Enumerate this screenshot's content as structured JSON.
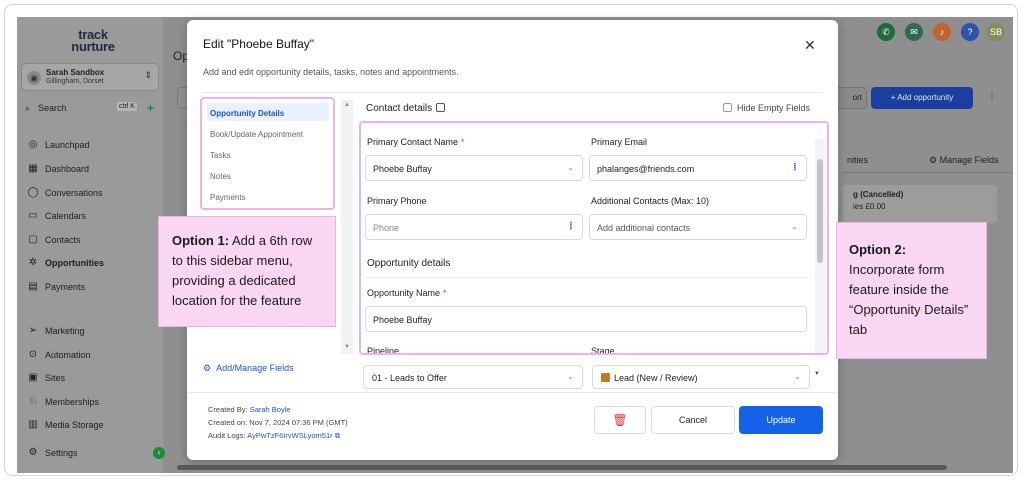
{
  "sidebar": {
    "logo_line1": "track",
    "logo_line2": "nurture",
    "account_name": "Sarah Sandbox",
    "account_location": "Gillingham, Dorset",
    "search_label": "Search",
    "search_shortcut": "ctrl K",
    "items": [
      {
        "label": "Launchpad",
        "icon": "rocket-icon"
      },
      {
        "label": "Dashboard",
        "icon": "grid-icon"
      },
      {
        "label": "Conversations",
        "icon": "chat-icon"
      },
      {
        "label": "Calendars",
        "icon": "calendar-icon"
      },
      {
        "label": "Contacts",
        "icon": "contacts-icon"
      },
      {
        "label": "Opportunities",
        "icon": "opportunities-icon"
      },
      {
        "label": "Payments",
        "icon": "payments-icon"
      },
      {
        "label": "Marketing",
        "icon": "send-icon"
      },
      {
        "label": "Automation",
        "icon": "automation-icon"
      },
      {
        "label": "Sites",
        "icon": "sites-icon"
      },
      {
        "label": "Memberships",
        "icon": "badge-icon"
      },
      {
        "label": "Media Storage",
        "icon": "folder-icon"
      },
      {
        "label": "Settings",
        "icon": "gear-icon"
      }
    ]
  },
  "background": {
    "title_fragment": "Opp",
    "port_fragment": "ort",
    "add_opportunity": "+ Add opportunity",
    "tab_fragment": "nities",
    "manage_fields": "Manage Fields",
    "card_title": "g (Cancelled)",
    "card_sub": "ies  £0.00",
    "avatar_initials": "SB"
  },
  "modal": {
    "title": "Edit \"Phoebe Buffay\"",
    "subtitle": "Add and edit opportunity details, tasks, notes and appointments.",
    "tabs": [
      "Opportunity Details",
      "Book/Update Appointment",
      "Tasks",
      "Notes",
      "Payments"
    ],
    "add_manage_fields": "Add/Manage Fields",
    "contact_details_heading": "Contact details",
    "hide_empty_fields": "Hide Empty Fields",
    "primary_contact_name_label": "Primary Contact Name",
    "primary_contact_name_value": "Phoebe Buffay",
    "primary_email_label": "Primary Email",
    "primary_email_value": "phalanges@friends.com",
    "primary_phone_label": "Primary Phone",
    "primary_phone_placeholder": "Phone",
    "additional_contacts_label": "Additional Contacts (Max: 10)",
    "additional_contacts_placeholder": "Add additional contacts",
    "opportunity_details_heading": "Opportunity details",
    "opportunity_name_label": "Opportunity Name",
    "opportunity_name_value": "Phoebe Buffay",
    "pipeline_label": "Pipeline",
    "pipeline_value": "01 - Leads to Offer",
    "stage_label": "Stage",
    "stage_value": "Lead (New / Review)",
    "required_mark": "*",
    "created_by_label": "Created By:",
    "created_by_value": "Sarah Boyle",
    "created_on_label": "Created on:",
    "created_on_value": "Nov 7, 2024 07:36 PM (GMT)",
    "audit_logs_label": "Audit Logs:",
    "audit_logs_value": "AyPwTzF6IrvWSLyom51r",
    "cancel": "Cancel",
    "update": "Update"
  },
  "callouts": {
    "option1_label": "Option 1:",
    "option1_text": "Add a 6th row to this sidebar menu, providing a dedicated location for the feature",
    "option2_label": "Option 2:",
    "option2_text": "Incorporate form feature inside the “Opportunity Details” tab"
  },
  "colors": {
    "accent_blue": "#1462e8",
    "highlight_pink": "#ecb4e6",
    "callout_pink": "#f9d6f1",
    "required_red": "#d33333"
  }
}
